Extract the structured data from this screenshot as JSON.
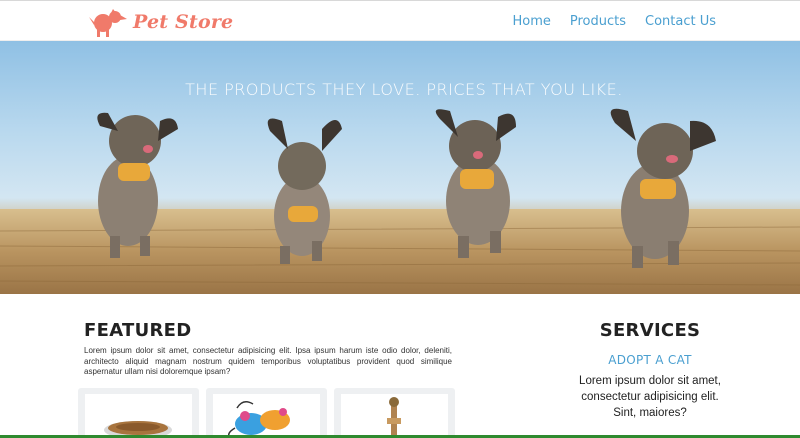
{
  "brand": {
    "name": "Pet Store",
    "accent": "#f07a6a"
  },
  "nav": [
    {
      "label": "Home"
    },
    {
      "label": "Products"
    },
    {
      "label": "Contact Us"
    }
  ],
  "hero": {
    "tagline": "THE PRODUCTS THEY LOVE. PRICES THAT YOU LIKE."
  },
  "featured": {
    "title": "FEATURED",
    "text": "Lorem ipsum dolor sit amet, consectetur adipisicing elit. Ipsa ipsum harum iste odio dolor, deleniti, architecto aliquid magnam nostrum quidem temporibus voluptatibus provident quod similique aspernatur ullam nisi doloremque ipsam?",
    "products": [
      {
        "icon": "pet-food-bowl-icon"
      },
      {
        "icon": "toy-mice-icon"
      },
      {
        "icon": "rope-toy-icon"
      }
    ]
  },
  "services": {
    "title": "SERVICES",
    "link": "ADOPT A CAT",
    "text": "Lorem ipsum dolor sit amet, consectetur adipisicing elit. Sint, maiores?"
  },
  "colors": {
    "link": "#4a9fd0",
    "footer_line": "#2f8a2f"
  }
}
